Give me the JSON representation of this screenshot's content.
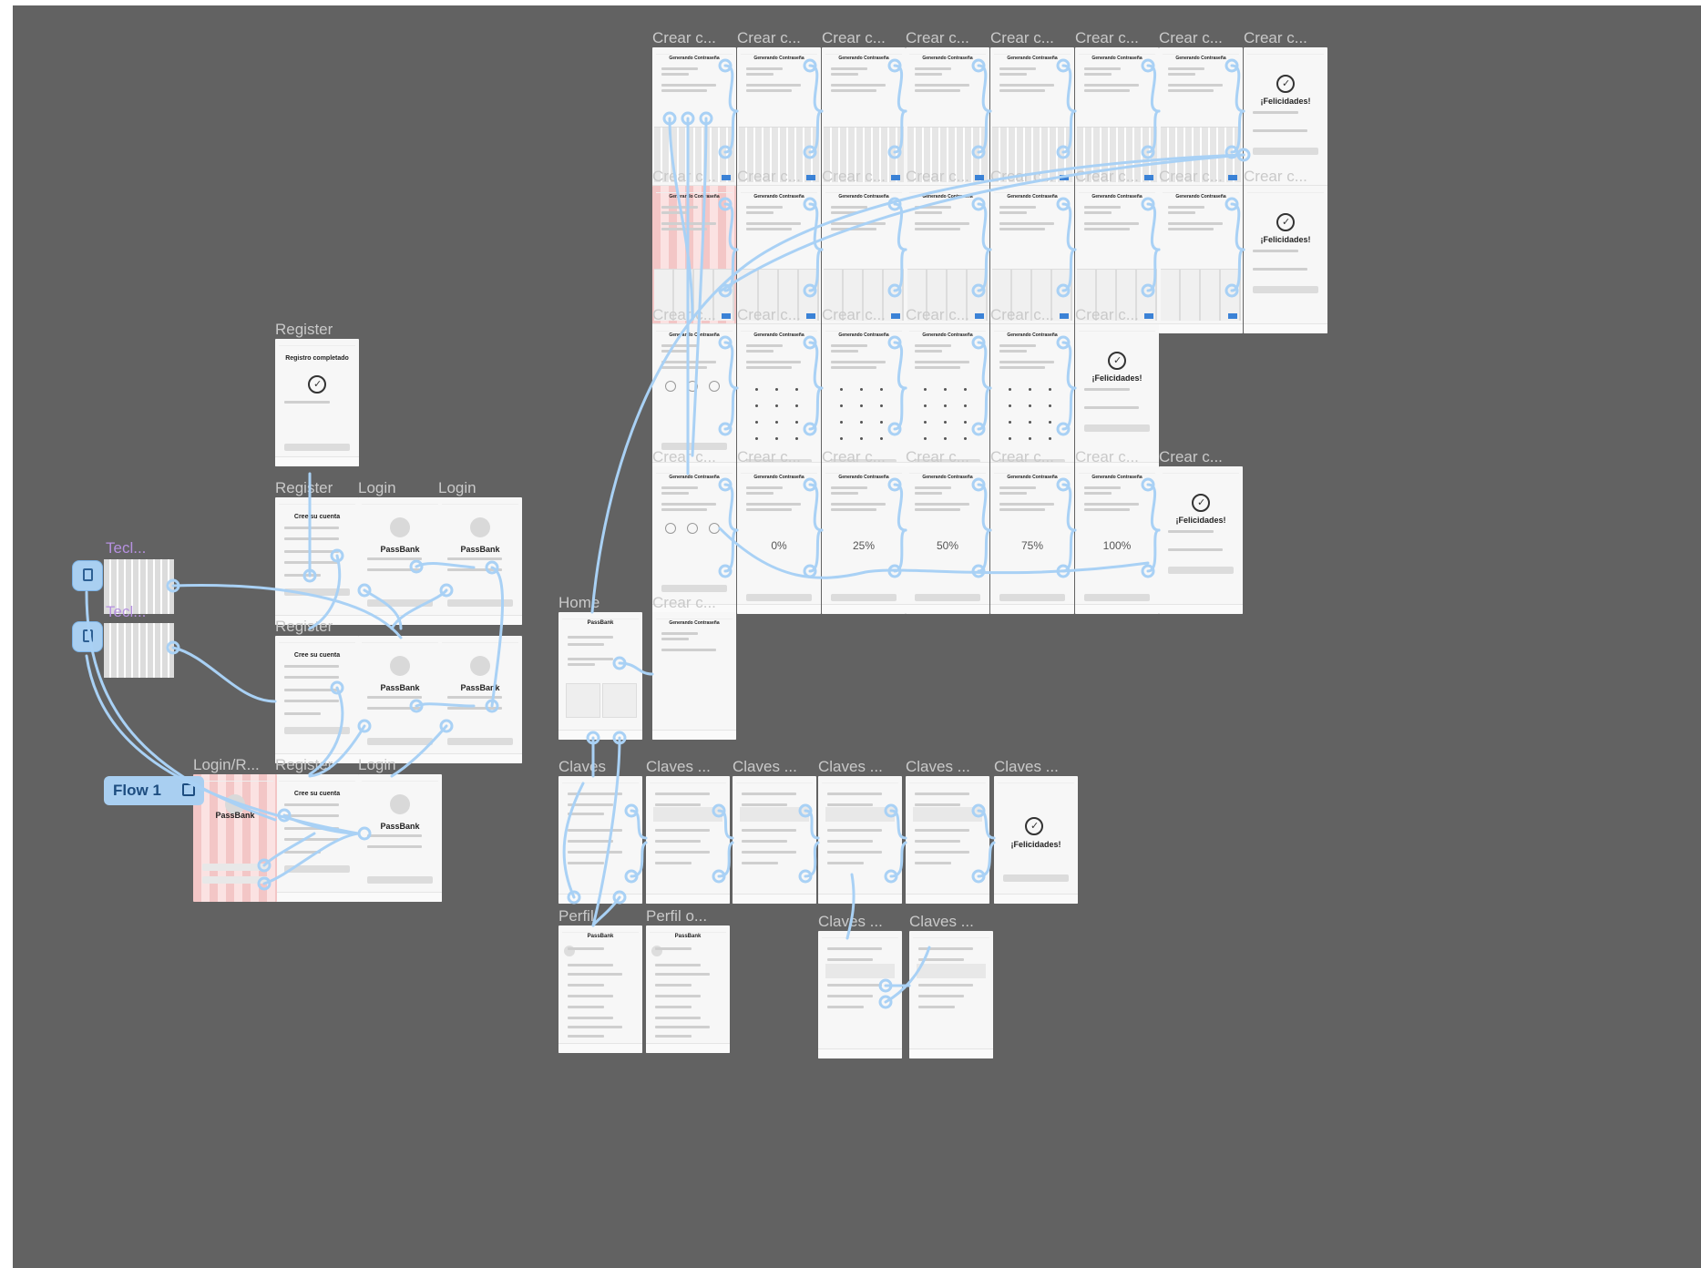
{
  "canvas": {
    "background": "#626262",
    "wire_color": "#a9d1f5"
  },
  "flow_button": {
    "label": "Flow 1"
  },
  "components": [
    {
      "label": "Tecl..."
    },
    {
      "label": "Tecl..."
    }
  ],
  "register_column": [
    {
      "label": "Register",
      "title": "Registro completado",
      "type": "done"
    },
    {
      "label": "Register",
      "title": "Cree su cuenta",
      "type": "form"
    },
    {
      "label": "Register",
      "title": "Cree su cuenta",
      "type": "form"
    },
    {
      "label": "Register",
      "title": "Cree su cuenta",
      "type": "form"
    }
  ],
  "login_frames": [
    {
      "label": "Login",
      "title": "PassBank"
    },
    {
      "label": "Login",
      "title": "PassBank"
    },
    {
      "label": "Login",
      "title": "PassBank"
    },
    {
      "label": "Login",
      "title": "PassBank"
    },
    {
      "label": "Login",
      "title": "PassBank"
    }
  ],
  "login_register": {
    "label": "Login/R...",
    "title": "PassBank"
  },
  "home": {
    "label": "Home",
    "title": "PassBank"
  },
  "crear_single": {
    "label": "Crear c...",
    "title": "Generando Contraseña"
  },
  "crear_rows": [
    {
      "label": "Crear c...",
      "count": 8,
      "kind": "qwerty",
      "final": "¡Felicidades!"
    },
    {
      "label": "Crear c...",
      "count": 8,
      "kind": "numeric",
      "final": "¡Felicidades!"
    },
    {
      "label": "Crear c...",
      "count": 6,
      "kind": "pattern",
      "final": "¡Felicidades!"
    },
    {
      "label": "Crear c...",
      "count": 7,
      "kind": "progress",
      "final": "¡Felicidades!",
      "percents": [
        "0%",
        "25%",
        "50%",
        "75%",
        "100%"
      ]
    }
  ],
  "claves": {
    "label": "Claves ...",
    "first_label": "Claves",
    "final": "¡Felicidades!"
  },
  "perfil": [
    {
      "label": "Perfil"
    },
    {
      "label": "Perfil o..."
    }
  ],
  "screen_title": "Generando Contraseña",
  "frame_title": "PassBank"
}
